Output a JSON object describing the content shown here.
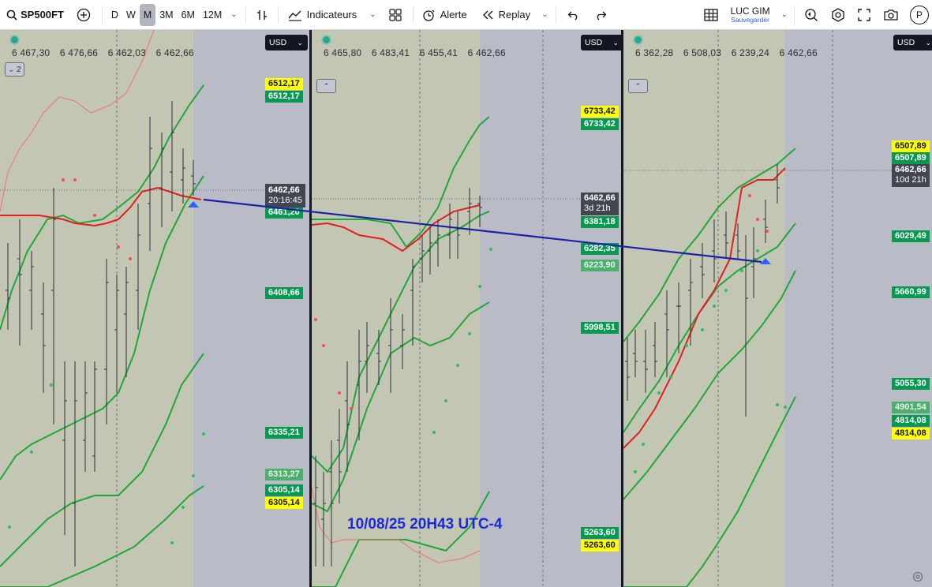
{
  "toolbar": {
    "symbol": "SP500FT",
    "intervals": [
      "D",
      "W",
      "M",
      "3M",
      "6M",
      "12M"
    ],
    "active_interval": "M",
    "indicators_label": "Indicateurs",
    "alert_label": "Alerte",
    "replay_label": "Replay",
    "layout_name": "LUC GIM",
    "layout_status": "Sauvegarder",
    "profile_initial": "P"
  },
  "panes": [
    {
      "ohlc": [
        "6 467,30",
        "6 476,66",
        "6 462,03",
        "6 462,66"
      ],
      "collapse_label": "2",
      "currency": "USD",
      "tags": [
        "6512,17",
        "6512,17",
        "6461,20",
        "6408,66",
        "6335,21",
        "6313,27",
        "6305,14",
        "6305,14"
      ],
      "current": {
        "price": "6462,66",
        "timer": "20:16:45"
      }
    },
    {
      "ohlc": [
        "6 465,80",
        "6 483,41",
        "6 455,41",
        "6 462,66"
      ],
      "currency": "USD",
      "tags": [
        "6733,42",
        "6733,42",
        "6381,18",
        "6282,35",
        "6223,90",
        "5998,51",
        "5263,60",
        "5263,60"
      ],
      "current": {
        "price": "6462,66",
        "timer": "3d 21h"
      }
    },
    {
      "ohlc": [
        "6 362,28",
        "6 508,03",
        "6 239,24",
        "6 462,66"
      ],
      "currency": "USD",
      "tags": [
        "6507,89",
        "6507,89",
        "6029,49",
        "5660,99",
        "5055,30",
        "4901,54",
        "4814,08",
        "4814,08"
      ],
      "current": {
        "price": "6462,66",
        "timer": "10d 21h"
      }
    }
  ],
  "annotation_text": "10/08/25 20H43 UTC-4",
  "colors": {
    "band": "#1fa83a",
    "basis": "#e31e1e",
    "trendline": "#1c22a6",
    "shade": "#c5c8b0",
    "annotation": "#1a2bd6"
  }
}
